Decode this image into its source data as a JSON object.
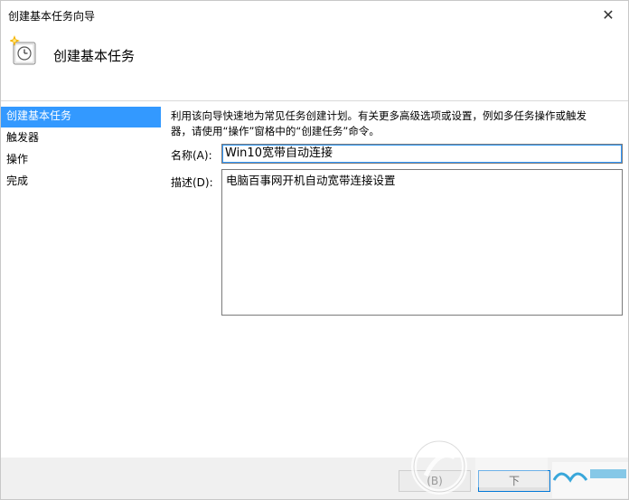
{
  "window": {
    "title": "创建基本任务向导",
    "close_glyph": "✕"
  },
  "header": {
    "title": "创建基本任务",
    "icon": "task-scheduler-clock-icon"
  },
  "sidebar": {
    "items": [
      {
        "label": "创建基本任务",
        "selected": true
      },
      {
        "label": "触发器",
        "selected": false
      },
      {
        "label": "操作",
        "selected": false
      },
      {
        "label": "完成",
        "selected": false
      }
    ]
  },
  "main": {
    "intro_line1": "利用该向导快速地为常见任务创建计划。有关更多高级选项或设置，例如多任务操作或触发",
    "intro_line2": "器，请使用“操作”窗格中的“创建任务”命令。",
    "name_label": "名称(A):",
    "name_value": "Win10宽带自动连接",
    "desc_label": "描述(D):",
    "desc_value": "电脑百事网开机自动宽带连接设置"
  },
  "footer": {
    "back_label": "(B)",
    "next_label": "下"
  },
  "colors": {
    "selection": "#3399ff",
    "focus": "#0078d7"
  }
}
